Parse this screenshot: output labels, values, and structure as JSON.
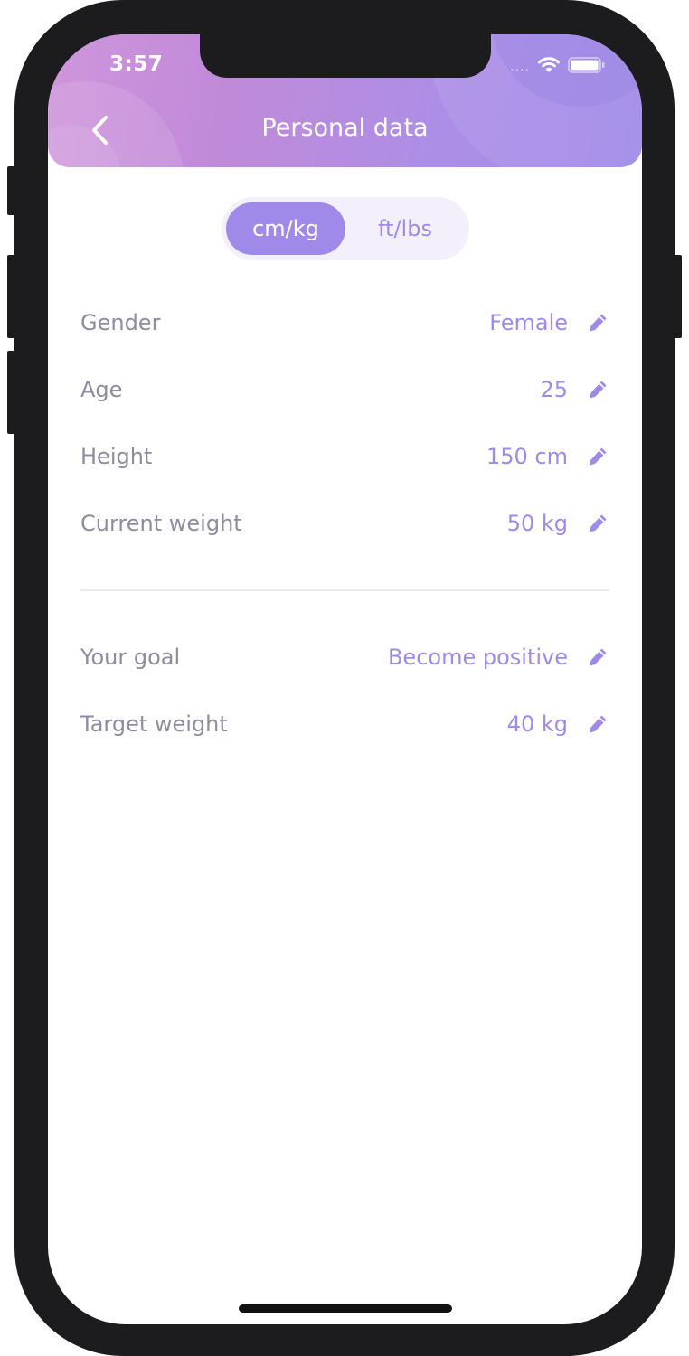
{
  "status_bar": {
    "time": "3:57",
    "signal_dots": "....",
    "icons": [
      "wifi-icon",
      "battery-icon"
    ]
  },
  "header": {
    "title": "Personal data",
    "back_icon": "chevron-left-icon"
  },
  "units_toggle": {
    "options": [
      {
        "label": "cm/kg",
        "selected": true
      },
      {
        "label": "ft/lbs",
        "selected": false
      }
    ]
  },
  "personal_rows": [
    {
      "label": "Gender",
      "value": "Female"
    },
    {
      "label": "Age",
      "value": "25"
    },
    {
      "label": "Height",
      "value": "150 cm"
    },
    {
      "label": "Current weight",
      "value": "50 kg"
    }
  ],
  "goal_rows": [
    {
      "label": "Your goal",
      "value": "Become positive"
    },
    {
      "label": "Target weight",
      "value": "40 kg"
    }
  ],
  "colors": {
    "accent": "#a08ae9",
    "label_text": "#8f8ba0",
    "header_gradient_start": "#cf96dc",
    "header_gradient_end": "#a08ae9",
    "toggle_background": "#f3f0fc"
  }
}
